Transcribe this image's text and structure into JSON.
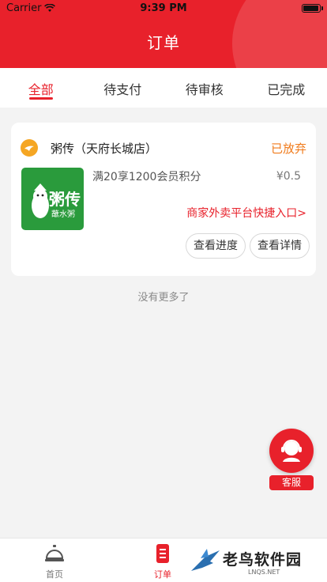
{
  "status_bar": {
    "carrier": "Carrier",
    "time": "9:39 PM"
  },
  "header": {
    "title": "订单"
  },
  "tabs": [
    {
      "label": "全部",
      "active": true
    },
    {
      "label": "待支付",
      "active": false
    },
    {
      "label": "待审核",
      "active": false
    },
    {
      "label": "已完成",
      "active": false
    }
  ],
  "order": {
    "store_name": "粥传（天府长城店）",
    "status": "已放弃",
    "thumb_text": "粥传",
    "thumb_subtext": "蘸水粥",
    "item_title": "满20享1200会员积分",
    "price": "¥0.5",
    "promo_link": "商家外卖平台快捷入口>",
    "btn_progress": "查看进度",
    "btn_details": "查看详情"
  },
  "no_more_text": "没有更多了",
  "customer_service": {
    "label": "客服"
  },
  "bottom_nav": {
    "home": "首页",
    "orders": "订单"
  },
  "watermark": {
    "text": "老鸟软件园",
    "sub": "LNQS.NET"
  },
  "colors": {
    "brand_red": "#e8212b",
    "status_orange": "#f07a1a",
    "thumb_green": "#2a9b3c"
  }
}
